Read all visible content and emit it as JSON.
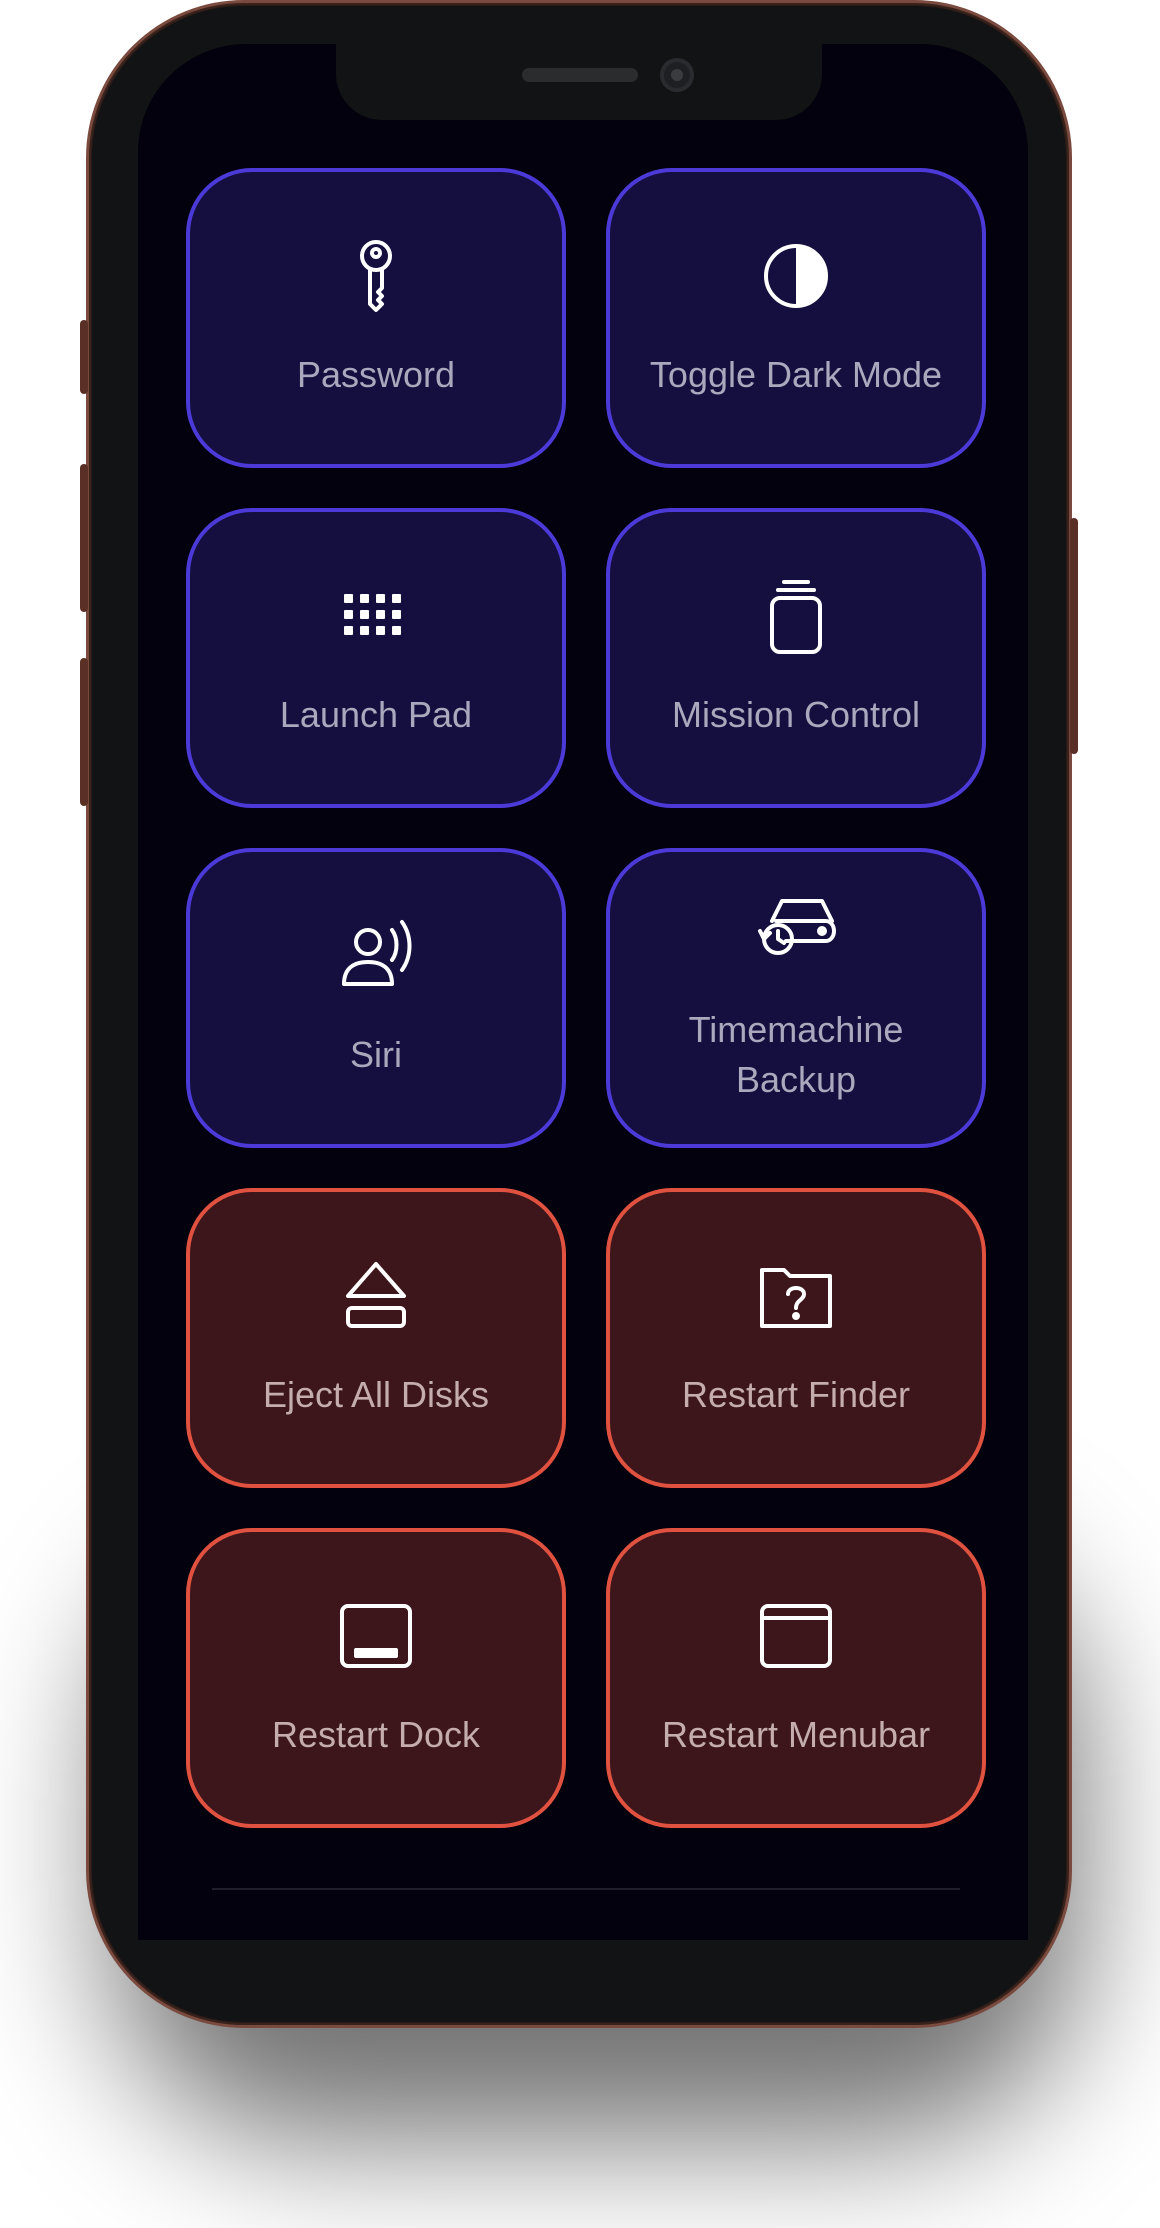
{
  "colors": {
    "blue_tile_bg": "#140f3e",
    "blue_tile_border": "#4c3ad8",
    "red_tile_bg": "#3c161b",
    "red_tile_border": "#e0523f",
    "screen_bg": "#02010d"
  },
  "tiles": [
    {
      "label": "Password",
      "icon": "key-icon",
      "theme": "blue"
    },
    {
      "label": "Toggle Dark Mode",
      "icon": "half-circle-icon",
      "theme": "blue"
    },
    {
      "label": "Launch Pad",
      "icon": "grid-dots-icon",
      "theme": "blue"
    },
    {
      "label": "Mission Control",
      "icon": "stacked-windows-icon",
      "theme": "blue"
    },
    {
      "label": "Siri",
      "icon": "person-speaking-icon",
      "theme": "blue"
    },
    {
      "label": "Timemachine Backup",
      "icon": "time-machine-drive-icon",
      "theme": "blue"
    },
    {
      "label": "Eject All Disks",
      "icon": "eject-icon",
      "theme": "red"
    },
    {
      "label": "Restart Finder",
      "icon": "folder-question-icon",
      "theme": "red"
    },
    {
      "label": "Restart Dock",
      "icon": "dock-icon",
      "theme": "red"
    },
    {
      "label": "Restart Menubar",
      "icon": "menubar-window-icon",
      "theme": "red"
    }
  ]
}
